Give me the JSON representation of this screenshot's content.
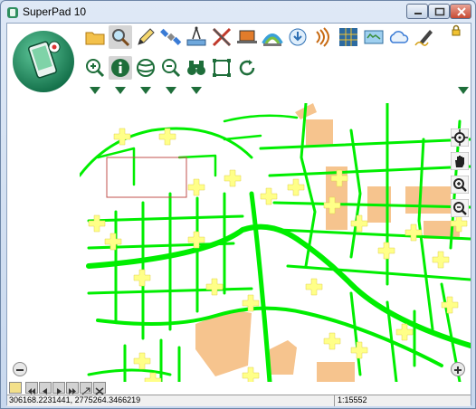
{
  "window": {
    "title": "SuperPad 10",
    "buttons": [
      "minimize",
      "maximize",
      "close"
    ]
  },
  "toolbar": {
    "row1_icons": [
      "folder-icon",
      "search-icon",
      "pencil-icon",
      "satellite-icon",
      "ruler-icon",
      "scissors-tools-icon",
      "laptop-icon",
      "rainbow-layer-icon",
      "globe-download-icon",
      "signal-icon",
      "grid-icon",
      "map-icon",
      "cloud-icon",
      "signature-pen-icon"
    ],
    "row2_icons": [
      "zoom-in-icon",
      "info-icon",
      "layers-icon",
      "zoom-out-icon",
      "binoculars-icon",
      "select-rect-icon",
      "refresh-icon"
    ],
    "selected": [
      "search-icon",
      "info-icon"
    ]
  },
  "map": {
    "tools": [
      "target-icon",
      "pan-hand-icon",
      "zoom-in-icon",
      "zoom-out-icon"
    ],
    "colors": {
      "roads": "#00ee00",
      "markers": "#ffff66",
      "buildings": "#f6c48e",
      "selection": "#c0504d"
    }
  },
  "status": {
    "coordinates": "306168.2231441, 2775264.3466219",
    "scale": "1:15552"
  }
}
